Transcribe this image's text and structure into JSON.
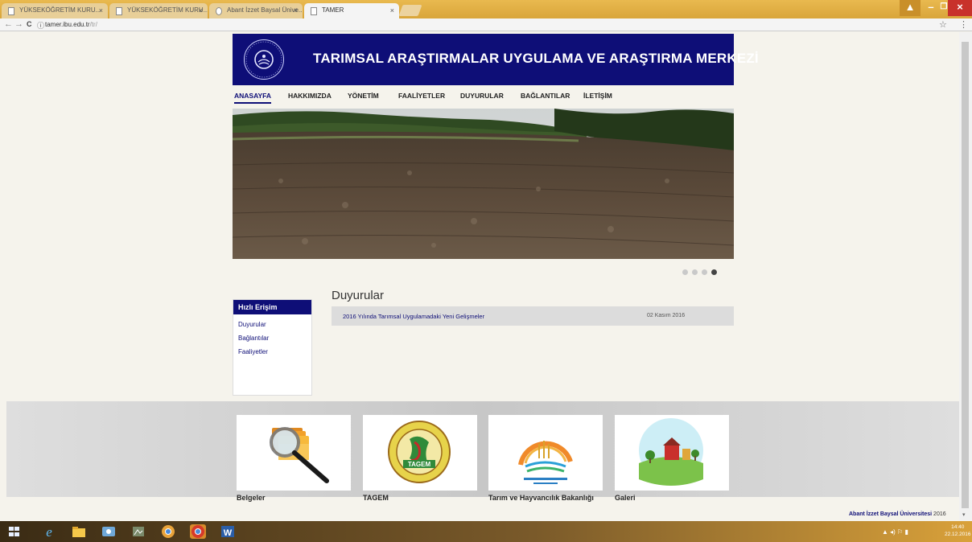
{
  "browser": {
    "tabs": [
      {
        "label": "YÜKSEKÖĞRETİM KURU...",
        "active": false
      },
      {
        "label": "YÜKSEKÖĞRETİM KURU...",
        "active": false
      },
      {
        "label": "Abant İzzet Baysal Ünive...",
        "active": false
      },
      {
        "label": "TAMER",
        "active": true
      }
    ],
    "tab_close": "×",
    "url_host": "tamer.ibu.edu.tr",
    "url_path": "/tr/",
    "back": "←",
    "forward": "→",
    "reload": "C",
    "info": "ⓘ",
    "star": "☆",
    "menu": "⋮",
    "window_controls": [
      "–",
      "❐",
      "×"
    ]
  },
  "site": {
    "title": "TARIMSAL ARAŞTIRMALAR UYGULAMA VE ARAŞTIRMA MERKEZİ",
    "nav": [
      "ANASAYFA",
      "HAKKIMIZDA",
      "YÖNETİM",
      "FAALİYETLER",
      "DUYURULAR",
      "BAĞLANTILAR",
      "İLETİŞİM"
    ],
    "nav_active": 0
  },
  "slider": {
    "count": 4,
    "active": 3
  },
  "quick_access": {
    "title": "Hızlı Erişim",
    "links": [
      "Duyurular",
      "Bağlantılar",
      "Faaliyetler"
    ]
  },
  "announcements": {
    "title": "Duyurular",
    "items": [
      {
        "text": "2016 Yılında Tarımsal Uygulamadaki Yeni Gelişmeler",
        "date": "02 Kasım 2016"
      }
    ]
  },
  "cards": [
    {
      "label": "Belgeler",
      "icon": "folder-magnifier-icon"
    },
    {
      "label": "TAGEM",
      "icon": "tagem-logo-icon"
    },
    {
      "label": "Tarım ve Hayvancılık Bakanlığı",
      "icon": "ministry-logo-icon"
    },
    {
      "label": "Galeri",
      "icon": "farm-gallery-icon"
    }
  ],
  "footer": {
    "org": "Abant İzzet Baysal Üniversitesi",
    "year": "2016"
  },
  "taskbar": {
    "time": "14:40",
    "date": "22.12.2016"
  },
  "colors": {
    "brand": "#0e0e77",
    "taskbar": "#d9a13a"
  }
}
